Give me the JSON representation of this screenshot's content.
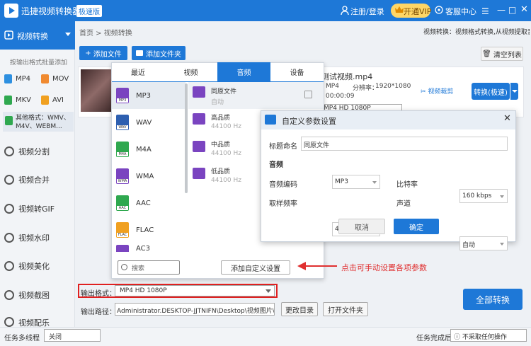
{
  "titlebar": {
    "app_title": "迅捷视频转换器",
    "edition": "极速版",
    "login": "注册/登录",
    "vip": "开通VIP",
    "service": "客服中心"
  },
  "sidebar": {
    "active": "视频转换",
    "batch_label": "按输出格式批量添加",
    "formats": [
      "MP4",
      "MOV",
      "MKV",
      "AVI"
    ],
    "other_formats": "其他格式：WMV、M4V、WEBM...",
    "items": [
      "视频分割",
      "视频合并",
      "视频转GIF",
      "视频水印",
      "视频美化",
      "视频截图",
      "视频配乐"
    ]
  },
  "breadcrumb": "首页 > 视频转换",
  "top_hint": "视频转换：视频格式转换,从视频提取音频",
  "toolbar": {
    "add_file": "添加文件",
    "add_folder": "添加文件夹",
    "clear_list": "清空列表"
  },
  "file": {
    "name": "测试视频.mp4",
    "format": "MP4",
    "resolution_label": "分辨率：",
    "resolution": "1920*1080",
    "duration": "00:00:09",
    "output_selected": "MP4  HD 1080P",
    "crop": "视频裁剪",
    "convert": "转换(极速)"
  },
  "popup": {
    "tabs": [
      "最近",
      "视频",
      "音频",
      "设备"
    ],
    "active_tab": "音频",
    "formats": [
      {
        "name": "MP3",
        "color": "#7a44c0"
      },
      {
        "name": "WAV",
        "color": "#2d5fb0"
      },
      {
        "name": "M4A",
        "color": "#2fa84f"
      },
      {
        "name": "WMA",
        "color": "#7a44c0"
      },
      {
        "name": "AAC",
        "color": "#2fa84f"
      },
      {
        "name": "FLAC",
        "color": "#f0a020"
      },
      {
        "name": "AC3",
        "color": "#7a44c0"
      }
    ],
    "qualities": [
      {
        "name": "同原文件",
        "sub": "自动"
      },
      {
        "name": "高品质",
        "sub": "44100 Hz"
      },
      {
        "name": "中品质",
        "sub": "44100 Hz"
      },
      {
        "name": "低品质",
        "sub": "44100 Hz"
      }
    ],
    "search_placeholder": "搜索",
    "add_custom": "添加自定义设置"
  },
  "annotation": "点击可手动设置各项参数",
  "dialog": {
    "title": "自定义参数设置",
    "name_label": "标题命名",
    "name_value": "同原文件",
    "section": "音频",
    "codec_label": "音频编码",
    "codec_value": "MP3",
    "bitrate_label": "比特率",
    "bitrate_value": "160 kbps",
    "samplerate_label": "取样频率",
    "samplerate_value": "48000 Hz",
    "channel_label": "声道",
    "channel_value": "自动",
    "cancel": "取消",
    "ok": "确定"
  },
  "bottom": {
    "output_format_label": "输出格式：",
    "output_format_value": "MP4  HD 1080P",
    "output_path_label": "输出路径：",
    "output_path_value": "Administrator.DESKTOP-JJTNIFN\\Desktop\\视频图片\\视频",
    "change_dir": "更改目录",
    "open_folder": "打开文件夹",
    "convert_all": "全部转换"
  },
  "status": {
    "multithread_label": "任务多线程",
    "multithread_value": "关闭",
    "done_label": "任务完成后",
    "done_value": "不采取任何操作"
  },
  "colors": {
    "accent": "#1e78d7",
    "annotation": "#e03030"
  }
}
